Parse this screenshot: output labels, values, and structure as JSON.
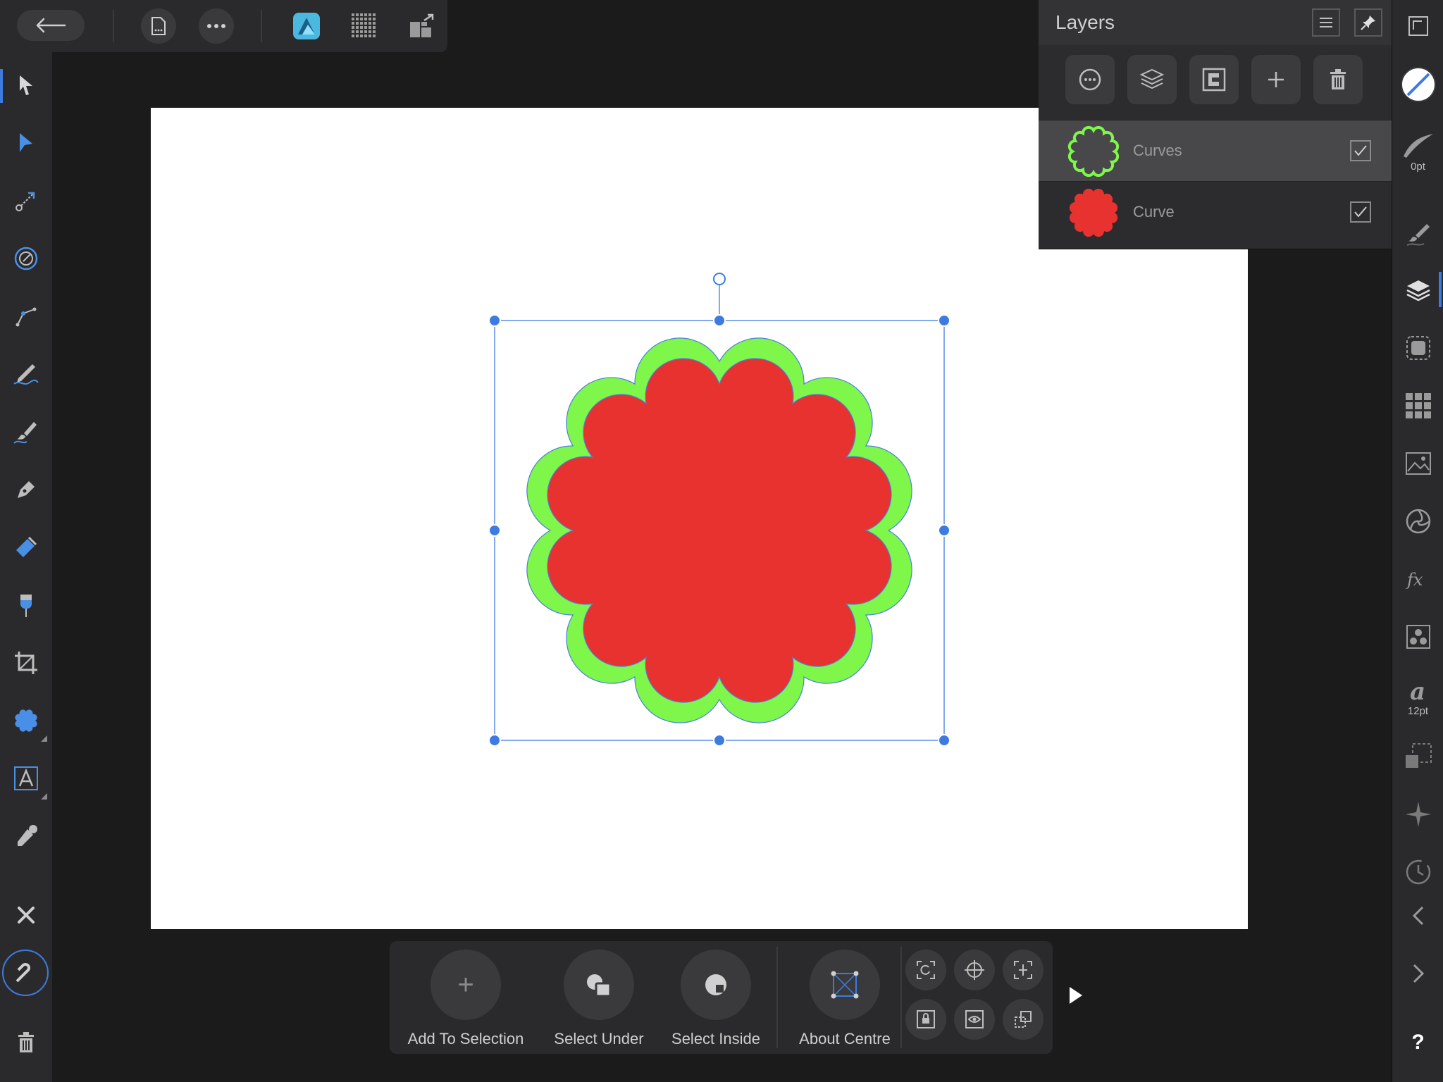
{
  "app": {
    "accent_color": "#3d7be0"
  },
  "topbar": {
    "icons": [
      "back-arrow-icon",
      "document-icon",
      "more-icon",
      "affinity-designer-persona-icon",
      "pixel-persona-icon",
      "export-persona-icon"
    ]
  },
  "layers_panel": {
    "title": "Layers",
    "layers": [
      {
        "name": "Curves",
        "visible": true,
        "thumbnail_color": "#7ef64a"
      },
      {
        "name": "Curve",
        "visible": true,
        "thumbnail_color": "#e7322f"
      }
    ]
  },
  "right_bar": {
    "stroke_width_label": "0pt",
    "font_size_label": "12pt",
    "help_label": "?"
  },
  "context_bar": {
    "add_to_selection": "Add To Selection",
    "select_under": "Select Under",
    "select_inside": "Select Inside",
    "about_centre": "About Centre",
    "add_icon_glyph": "+"
  },
  "shape": {
    "fill_color": "#e7322f",
    "outline_color": "#7ef64a"
  },
  "left_toolbar": {
    "tools": [
      "move-tool-icon",
      "node-tool-icon",
      "point-transform-tool-icon",
      "corner-tool-icon",
      "pen-tool-icon",
      "pencil-tool-icon",
      "vector-brush-tool-icon",
      "fill-pen-tool-icon",
      "fill-tool-icon",
      "transparency-tool-icon",
      "crop-tool-icon",
      "shape-tool-icon",
      "text-tool-icon",
      "color-picker-icon",
      "close-icon",
      "snapping-icon",
      "trash-icon"
    ]
  }
}
